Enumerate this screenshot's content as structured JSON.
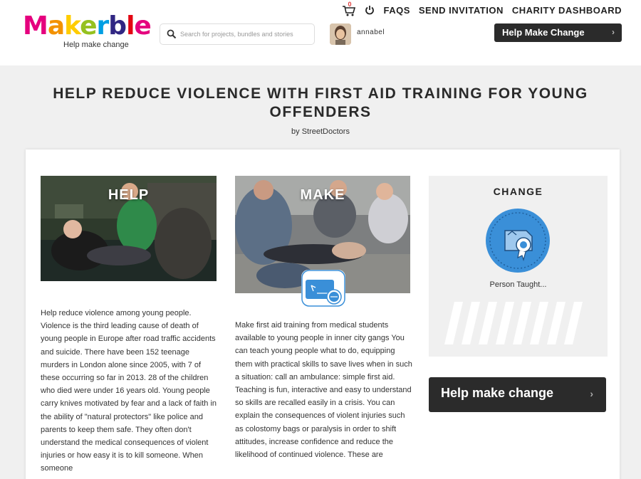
{
  "brand": {
    "logo_letters": [
      "M",
      "a",
      "k",
      "e",
      "r",
      "b",
      "l",
      "e"
    ],
    "logo_colors": [
      "#e5007e",
      "#f39200",
      "#ffcc00",
      "#95c11f",
      "#009fe3",
      "#312783",
      "#e30613",
      "#e5007e"
    ],
    "tagline": "Help make change"
  },
  "search": {
    "placeholder": "Search for projects, bundles and stories"
  },
  "user": {
    "name": "annabel"
  },
  "top_nav": {
    "cart_count": "0",
    "faqs": "FAQS",
    "send_invitation": "SEND INVITATION",
    "charity_dashboard": "CHARITY DASHBOARD",
    "help_make_change": "Help Make Change"
  },
  "project": {
    "title": "HELP REDUCE VIOLENCE WITH FIRST AID TRAINING FOR YOUNG OFFENDERS",
    "byline": "by StreetDoctors"
  },
  "columns": {
    "help": {
      "label": "HELP",
      "text": "Help reduce violence among young people. Violence is the third leading cause of death of young people in Europe after road traffic accidents and suicide. There have been 152 teenage murders in London alone since 2005, with 7 of these occurring so far in 2013. 28 of the children who died were under 16 years old. Young people carry knives motivated by fear and a lack of faith in the ability of \"natural protectors\" like police and parents to keep them safe. They often don't understand the medical consequences of violent injuries or how easy it is to kill someone. When someone"
    },
    "make": {
      "label": "MAKE",
      "text": "Make first aid training from medical students available to young people in inner city gangs You can teach young people what to do, equipping them with practical skills to save lives when in such a situation: call an ambulance: simple first aid. Teaching is fun, interactive and easy to understand so skills are recalled easily in a crisis. You can explain the consequences of violent injuries such as colostomy bags or paralysis in order to shift attitudes, increase confidence and reduce the likelihood of continued violence. These are"
    },
    "change": {
      "title": "CHANGE",
      "caption": "Person Taught...",
      "icon": "certificate-icon",
      "accent": "#3a8fd8"
    }
  },
  "cta": {
    "help_make_change": "Help make change"
  }
}
